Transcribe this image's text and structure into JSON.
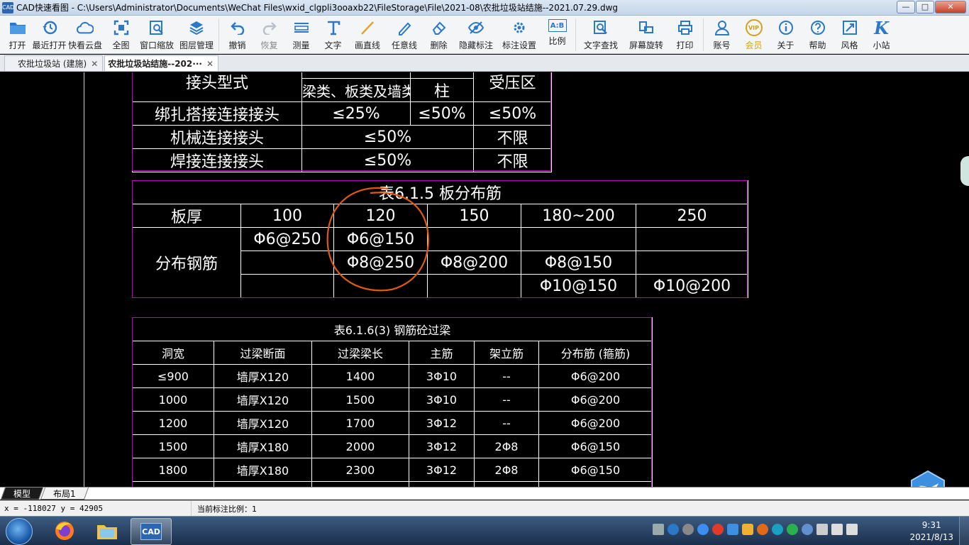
{
  "window": {
    "title": "CAD快速看图 - C:\\Users\\Administrator\\Documents\\WeChat Files\\wxid_clgpli3ooaxb22\\FileStorage\\File\\2021-08\\农批垃圾站结施--2021.07.29.dwg",
    "app_icon_text": "CAD",
    "minimize": "—",
    "maximize": "□",
    "close": "✕"
  },
  "toolbar": {
    "items": [
      {
        "label": "打开",
        "icon": "folder-icon"
      },
      {
        "label": "最近打开",
        "icon": "history-icon"
      },
      {
        "label": "快看云盘",
        "icon": "cloud-icon"
      },
      {
        "label": "全图",
        "icon": "fullview-icon"
      },
      {
        "label": "窗口缩放",
        "icon": "window-zoom-icon"
      },
      {
        "label": "图层管理",
        "icon": "layers-icon"
      },
      {
        "label": "撤销",
        "icon": "undo-icon"
      },
      {
        "label": "恢复",
        "icon": "redo-icon"
      },
      {
        "label": "测量",
        "icon": "measure-icon"
      },
      {
        "label": "文字",
        "icon": "text-icon"
      },
      {
        "label": "画直线",
        "icon": "line-icon"
      },
      {
        "label": "任意线",
        "icon": "freehand-icon"
      },
      {
        "label": "删除",
        "icon": "eraser-icon"
      },
      {
        "label": "隐藏标注",
        "icon": "eye-hide-icon"
      },
      {
        "label": "标注设置",
        "icon": "annotation-settings-icon"
      },
      {
        "label": "比例",
        "icon": "scale-icon"
      },
      {
        "label": "文字查找",
        "icon": "text-search-icon"
      },
      {
        "label": "屏幕旋转",
        "icon": "rotate-screen-icon"
      },
      {
        "label": "打印",
        "icon": "printer-icon"
      },
      {
        "label": "账号",
        "icon": "account-icon"
      },
      {
        "label": "会员",
        "icon": "vip-icon"
      },
      {
        "label": "关于",
        "icon": "info-icon"
      },
      {
        "label": "帮助",
        "icon": "help-icon"
      },
      {
        "label": "风格",
        "icon": "style-icon"
      },
      {
        "label": "小站",
        "icon": "k-logo-icon"
      }
    ],
    "vip_badge": "VIP",
    "scale_icon_text": "A:B"
  },
  "tabs": [
    {
      "label": "农批垃圾站 (建施)",
      "close": "✕",
      "active": false
    },
    {
      "label": "农批垃圾站结施--202···",
      "close": "✕",
      "active": true
    }
  ],
  "drawing": {
    "splice_table": {
      "header_partial": "接头型式",
      "subheaders": [
        "梁类、板类及墙类",
        "柱",
        "受压区"
      ],
      "rows": [
        [
          "绑扎搭接连接接头",
          "≤25%",
          "≤50%",
          "≤50%"
        ],
        [
          "机械连接接头",
          "≤50%",
          "不限"
        ],
        [
          "焊接连接接头",
          "≤50%",
          "不限"
        ]
      ]
    },
    "slab_table": {
      "title": "表6.1.5  板分布筋",
      "header": [
        "板厚",
        "100",
        "120",
        "150",
        "180~200",
        "250"
      ],
      "row_label": "分布钢筋",
      "rows": [
        [
          "Φ6@250",
          "Φ6@150",
          "",
          "",
          ""
        ],
        [
          "",
          "Φ8@250",
          "Φ8@200",
          "Φ8@150",
          ""
        ],
        [
          "",
          "",
          "",
          "Φ10@150",
          "Φ10@200"
        ]
      ]
    },
    "lintel_table": {
      "title": "表6.1.6(3)   钢筋砼过梁",
      "header": [
        "洞宽",
        "过梁断面",
        "过梁梁长",
        "主筋",
        "架立筋",
        "分布筋 (箍筋)"
      ],
      "rows": [
        [
          "≤900",
          "墙厚X120",
          "1400",
          "3Φ10",
          "--",
          "Φ6@200"
        ],
        [
          "1000",
          "墙厚X120",
          "1500",
          "3Φ10",
          "--",
          "Φ6@200"
        ],
        [
          "1200",
          "墙厚X120",
          "1700",
          "3Φ12",
          "--",
          "Φ6@200"
        ],
        [
          "1500",
          "墙厚X180",
          "2000",
          "3Φ12",
          "2Φ8",
          "Φ6@150"
        ],
        [
          "1800",
          "墙厚X180",
          "2300",
          "3Φ12",
          "2Φ8",
          "Φ6@150"
        ]
      ]
    },
    "colors": {
      "line": "#ffffff",
      "frame": "#c400c4",
      "markup": "#e05a10"
    }
  },
  "layout_tabs": [
    {
      "label": "模型",
      "active": true
    },
    {
      "label": "布局1",
      "active": false
    }
  ],
  "status": {
    "coords": "x = -118027  y = 42905",
    "scale": "当前标注比例：1"
  },
  "taskbar": {
    "apps": [
      "firefox-icon",
      "explorer-icon",
      "cad-icon"
    ],
    "cad_label": "CAD",
    "time": "9:31",
    "date": "2021/8/13"
  }
}
